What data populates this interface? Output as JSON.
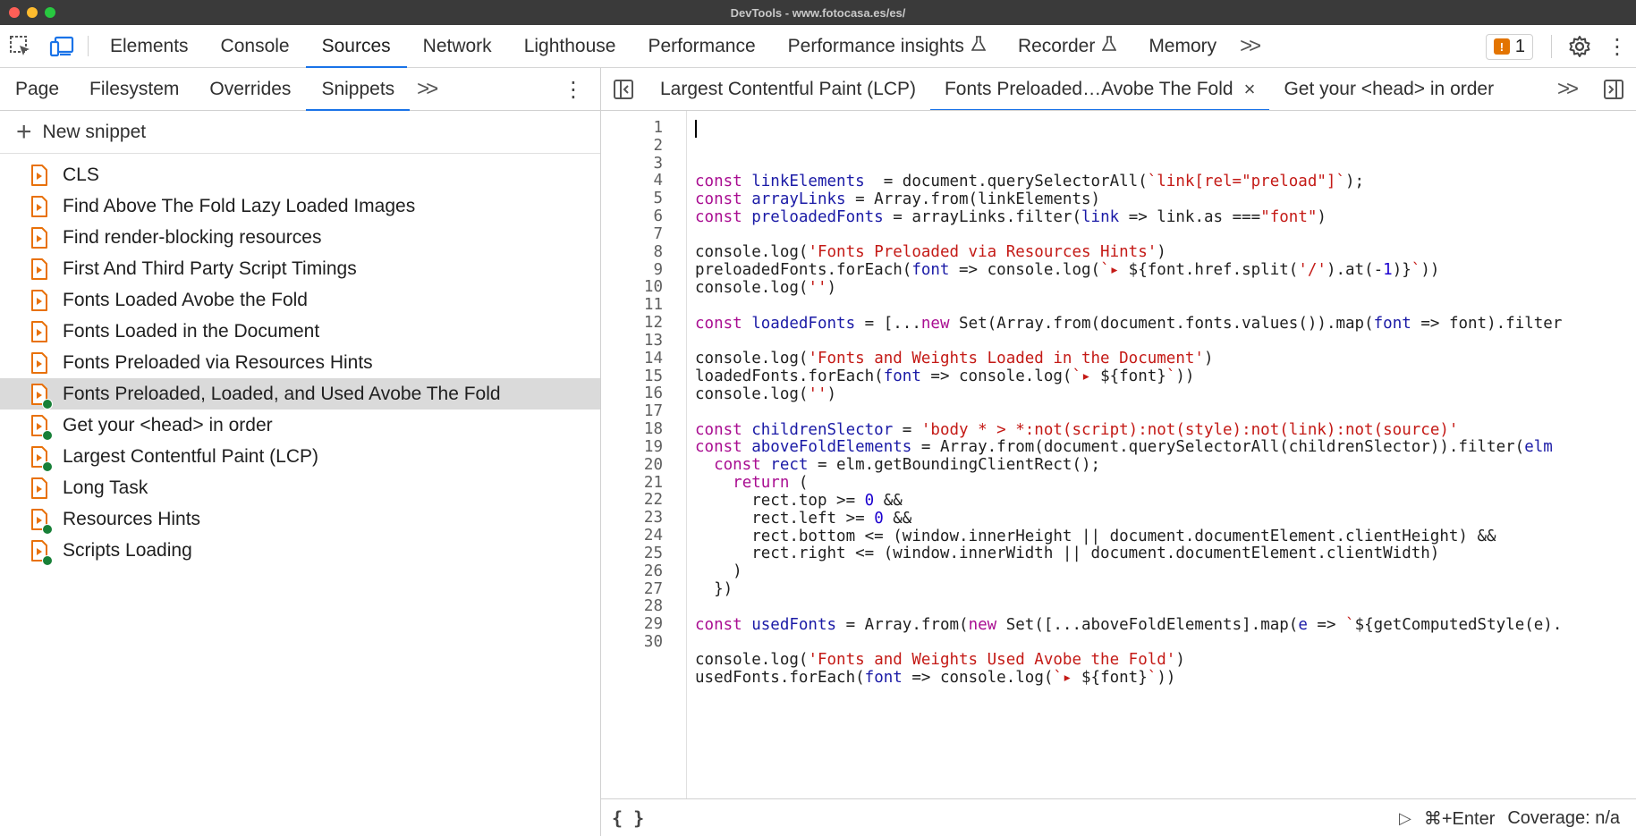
{
  "window": {
    "title": "DevTools - www.fotocasa.es/es/"
  },
  "main_tabs": [
    {
      "label": "Elements",
      "active": false,
      "flask": false
    },
    {
      "label": "Console",
      "active": false,
      "flask": false
    },
    {
      "label": "Sources",
      "active": true,
      "flask": false
    },
    {
      "label": "Network",
      "active": false,
      "flask": false
    },
    {
      "label": "Lighthouse",
      "active": false,
      "flask": false
    },
    {
      "label": "Performance",
      "active": false,
      "flask": false
    },
    {
      "label": "Performance insights",
      "active": false,
      "flask": true
    },
    {
      "label": "Recorder",
      "active": false,
      "flask": true
    },
    {
      "label": "Memory",
      "active": false,
      "flask": false
    }
  ],
  "issues": {
    "count": "1"
  },
  "sub_tabs": [
    {
      "label": "Page",
      "active": false
    },
    {
      "label": "Filesystem",
      "active": false
    },
    {
      "label": "Overrides",
      "active": false
    },
    {
      "label": "Snippets",
      "active": true
    }
  ],
  "new_snippet_label": "New snippet",
  "snippets": [
    {
      "name": "CLS",
      "dot": false,
      "selected": false
    },
    {
      "name": "Find Above The Fold Lazy Loaded Images",
      "dot": false,
      "selected": false
    },
    {
      "name": "Find render-blocking resources",
      "dot": false,
      "selected": false
    },
    {
      "name": "First And Third Party Script Timings",
      "dot": false,
      "selected": false
    },
    {
      "name": "Fonts Loaded Avobe the Fold",
      "dot": false,
      "selected": false
    },
    {
      "name": "Fonts Loaded in the Document",
      "dot": false,
      "selected": false
    },
    {
      "name": "Fonts Preloaded via Resources Hints",
      "dot": false,
      "selected": false
    },
    {
      "name": "Fonts Preloaded, Loaded, and Used Avobe The Fold",
      "dot": true,
      "selected": true
    },
    {
      "name": "Get your <head> in order",
      "dot": true,
      "selected": false
    },
    {
      "name": "Largest Contentful Paint (LCP)",
      "dot": true,
      "selected": false
    },
    {
      "name": "Long Task",
      "dot": false,
      "selected": false
    },
    {
      "name": "Resources Hints",
      "dot": true,
      "selected": false
    },
    {
      "name": "Scripts Loading",
      "dot": true,
      "selected": false
    }
  ],
  "editor_tabs": [
    {
      "label": "Largest Contentful Paint (LCP)",
      "active": false,
      "closable": false
    },
    {
      "label": "Fonts Preloaded…Avobe The Fold",
      "active": true,
      "closable": true
    },
    {
      "label": "Get your <head> in order",
      "active": false,
      "closable": false
    }
  ],
  "code_lines": [
    [
      [
        "kw",
        "const "
      ],
      [
        "vd",
        "linkElements"
      ],
      [
        "",
        "  = document.querySelectorAll("
      ],
      [
        "st",
        "`link[rel=\"preload\"]`"
      ],
      [
        "",
        ");"
      ]
    ],
    [
      [
        "kw",
        "const "
      ],
      [
        "vd",
        "arrayLinks"
      ],
      [
        "",
        " = Array.from(linkElements)"
      ]
    ],
    [
      [
        "kw",
        "const "
      ],
      [
        "vd",
        "preloadedFonts"
      ],
      [
        "",
        " = arrayLinks.filter("
      ],
      [
        "vd",
        "link"
      ],
      [
        "",
        " => link.as ==="
      ],
      [
        "st",
        "\"font\""
      ],
      [
        "",
        ")"
      ]
    ],
    [],
    [
      [
        "",
        "console.log("
      ],
      [
        "st",
        "'Fonts Preloaded via Resources Hints'"
      ],
      [
        "",
        ")"
      ]
    ],
    [
      [
        "",
        "preloadedFonts.forEach("
      ],
      [
        "vd",
        "font"
      ],
      [
        "",
        " => console.log("
      ],
      [
        "st",
        "`▸ "
      ],
      [
        "",
        "${font.href.split("
      ],
      [
        "st",
        "'/'"
      ],
      [
        "",
        ").at(-"
      ],
      [
        "nm",
        "1"
      ],
      [
        "",
        ")}"
      ],
      [
        "st",
        "`"
      ],
      [
        "",
        "))"
      ]
    ],
    [
      [
        "",
        "console.log("
      ],
      [
        "st",
        "''"
      ],
      [
        "",
        ")"
      ]
    ],
    [],
    [
      [
        "kw",
        "const "
      ],
      [
        "vd",
        "loadedFonts"
      ],
      [
        "",
        " = [..."
      ],
      [
        "kw",
        "new "
      ],
      [
        "",
        "Set(Array.from(document.fonts.values()).map("
      ],
      [
        "vd",
        "font"
      ],
      [
        "",
        " => font).filter"
      ]
    ],
    [],
    [
      [
        "",
        "console.log("
      ],
      [
        "st",
        "'Fonts and Weights Loaded in the Document'"
      ],
      [
        "",
        ")"
      ]
    ],
    [
      [
        "",
        "loadedFonts.forEach("
      ],
      [
        "vd",
        "font"
      ],
      [
        "",
        " => console.log("
      ],
      [
        "st",
        "`▸ "
      ],
      [
        "",
        "${font}"
      ],
      [
        "st",
        "`"
      ],
      [
        "",
        "))"
      ]
    ],
    [
      [
        "",
        "console.log("
      ],
      [
        "st",
        "''"
      ],
      [
        "",
        ")"
      ]
    ],
    [],
    [
      [
        "kw",
        "const "
      ],
      [
        "vd",
        "childrenSlector"
      ],
      [
        "",
        " = "
      ],
      [
        "st",
        "'body * > *:not(script):not(style):not(link):not(source)'"
      ]
    ],
    [
      [
        "kw",
        "const "
      ],
      [
        "vd",
        "aboveFoldElements"
      ],
      [
        "",
        " = Array.from(document.querySelectorAll(childrenSlector)).filter("
      ],
      [
        "vd",
        "elm"
      ]
    ],
    [
      [
        "",
        "  "
      ],
      [
        "kw",
        "const "
      ],
      [
        "vd",
        "rect"
      ],
      [
        "",
        " = elm.getBoundingClientRect();"
      ]
    ],
    [
      [
        "",
        "    "
      ],
      [
        "kw",
        "return"
      ],
      [
        "",
        " ("
      ]
    ],
    [
      [
        "",
        "      rect.top >= "
      ],
      [
        "nm",
        "0"
      ],
      [
        "",
        " &&"
      ]
    ],
    [
      [
        "",
        "      rect.left >= "
      ],
      [
        "nm",
        "0"
      ],
      [
        "",
        " &&"
      ]
    ],
    [
      [
        "",
        "      rect.bottom <= (window.innerHeight || document.documentElement.clientHeight) &&"
      ]
    ],
    [
      [
        "",
        "      rect.right <= (window.innerWidth || document.documentElement.clientWidth)"
      ]
    ],
    [
      [
        "",
        "    )"
      ]
    ],
    [
      [
        "",
        "  })"
      ]
    ],
    [],
    [
      [
        "kw",
        "const "
      ],
      [
        "vd",
        "usedFonts"
      ],
      [
        "",
        " = Array.from("
      ],
      [
        "kw",
        "new "
      ],
      [
        "",
        "Set([...aboveFoldElements].map("
      ],
      [
        "vd",
        "e"
      ],
      [
        "",
        " => "
      ],
      [
        "st",
        "`"
      ],
      [
        "",
        "${getComputedStyle(e)."
      ]
    ],
    [],
    [
      [
        "",
        "console.log("
      ],
      [
        "st",
        "'Fonts and Weights Used Avobe the Fold'"
      ],
      [
        "",
        ")"
      ]
    ],
    [
      [
        "",
        "usedFonts.forEach("
      ],
      [
        "vd",
        "font"
      ],
      [
        "",
        " => console.log("
      ],
      [
        "st",
        "`▸ "
      ],
      [
        "",
        "${font}"
      ],
      [
        "st",
        "`"
      ],
      [
        "",
        "))"
      ]
    ],
    []
  ],
  "status_bar": {
    "format_button": "{ }",
    "run_shortcut": "⌘+Enter",
    "coverage": "Coverage: n/a"
  },
  "colors": {
    "accent": "#1a73e8",
    "snippet_icon": "#e8710a",
    "snippet_dot": "#188038"
  }
}
